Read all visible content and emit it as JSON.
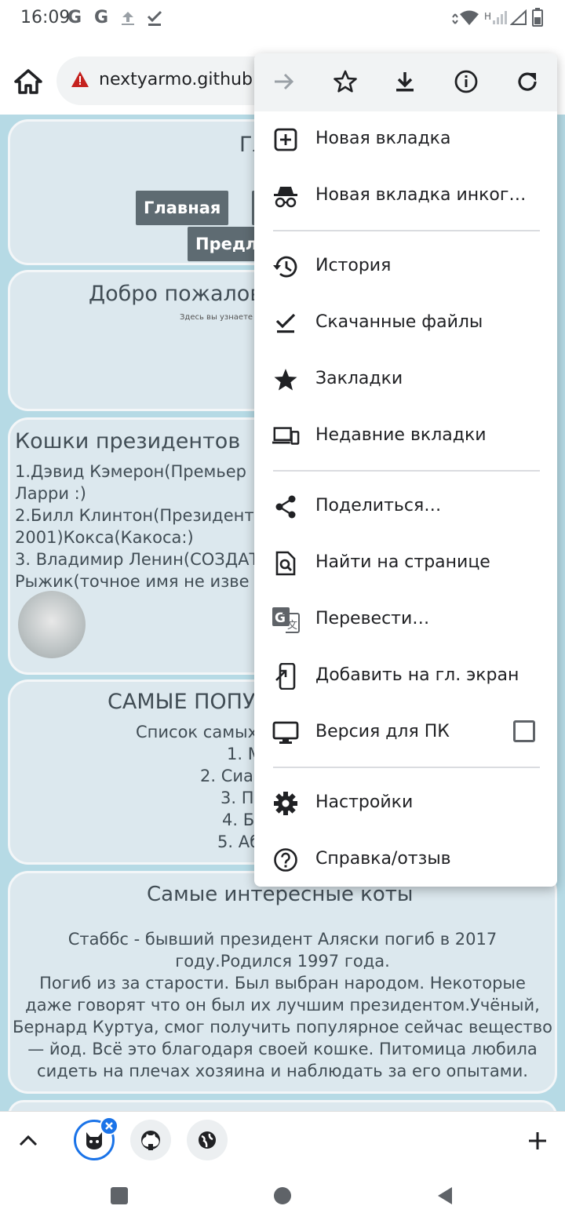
{
  "status": {
    "time": "16:09",
    "left_icons": [
      "G",
      "G"
    ],
    "network_letter": "H"
  },
  "browser": {
    "url": "nextyarmo.github.i"
  },
  "page": {
    "header": {
      "title": "Гл",
      "nav_home": "Главная",
      "nav_offers": "Предло"
    },
    "welcome": {
      "title": "Добро пожалов",
      "subtitle": "Здесь вы узнаете"
    },
    "presidents": {
      "title": "Кошки президентов",
      "lines": [
        "1.Дэвид Кэмерон(Премьер",
        "Ларри :)",
        "2.Билл Клинтон(Президент",
        "2001)Кокса(Какоса:)",
        "3. Владимир Ленин(СОЗДАТ",
        "Рыжик(точное имя не изве"
      ]
    },
    "popular": {
      "title": "САМЫЕ ПОПУ",
      "intro": "Список самых",
      "items": [
        "1. М",
        "2. Сиам",
        "3. П",
        "4. Б",
        "5. Аб"
      ]
    },
    "interesting": {
      "title": "Самые интересные коты",
      "lines": [
        "Стаббс - бывший президент Аляски погиб в 2017",
        "году.Родился 1997 года.",
        "Погиб из за старости. Был выбран народом. Некоторые",
        "даже говорят что он был их лучшим президентом.Учёный,",
        "Бернард Куртуа, смог получить популярное сейчас вещество",
        "— йод. Всё это благодаря своей кошке. Питомица любила",
        "сидеть на плечах хозяина и наблюдать за его опытами."
      ]
    }
  },
  "menu": {
    "top_icons": [
      "forward-icon",
      "bookmark-star-icon",
      "download-icon",
      "info-icon",
      "reload-icon"
    ],
    "items": [
      {
        "label": "Новая вкладка",
        "icon": "new-tab-icon"
      },
      {
        "label": "Новая вкладка инког…",
        "icon": "incognito-icon"
      },
      {
        "label": "История",
        "icon": "history-icon"
      },
      {
        "label": "Скачанные файлы",
        "icon": "downloads-icon"
      },
      {
        "label": "Закладки",
        "icon": "bookmarks-icon"
      },
      {
        "label": "Недавние вкладки",
        "icon": "recent-tabs-icon"
      },
      {
        "label": "Поделиться…",
        "icon": "share-icon"
      },
      {
        "label": "Найти на странице",
        "icon": "find-in-page-icon"
      },
      {
        "label": "Перевести…",
        "icon": "translate-icon"
      },
      {
        "label": "Добавить на гл. экран",
        "icon": "add-to-home-icon"
      },
      {
        "label": "Версия для ПК",
        "icon": "desktop-icon",
        "checked": false
      },
      {
        "label": "Настройки",
        "icon": "settings-icon"
      },
      {
        "label": "Справка/отзыв",
        "icon": "help-icon"
      }
    ]
  },
  "colors": {
    "page_bg": "#b6dae5",
    "card_bg": "#dce8ee",
    "nav_button": "#5e6b72",
    "menu_top": "#f1f3f4",
    "accent": "#1a73e8"
  }
}
